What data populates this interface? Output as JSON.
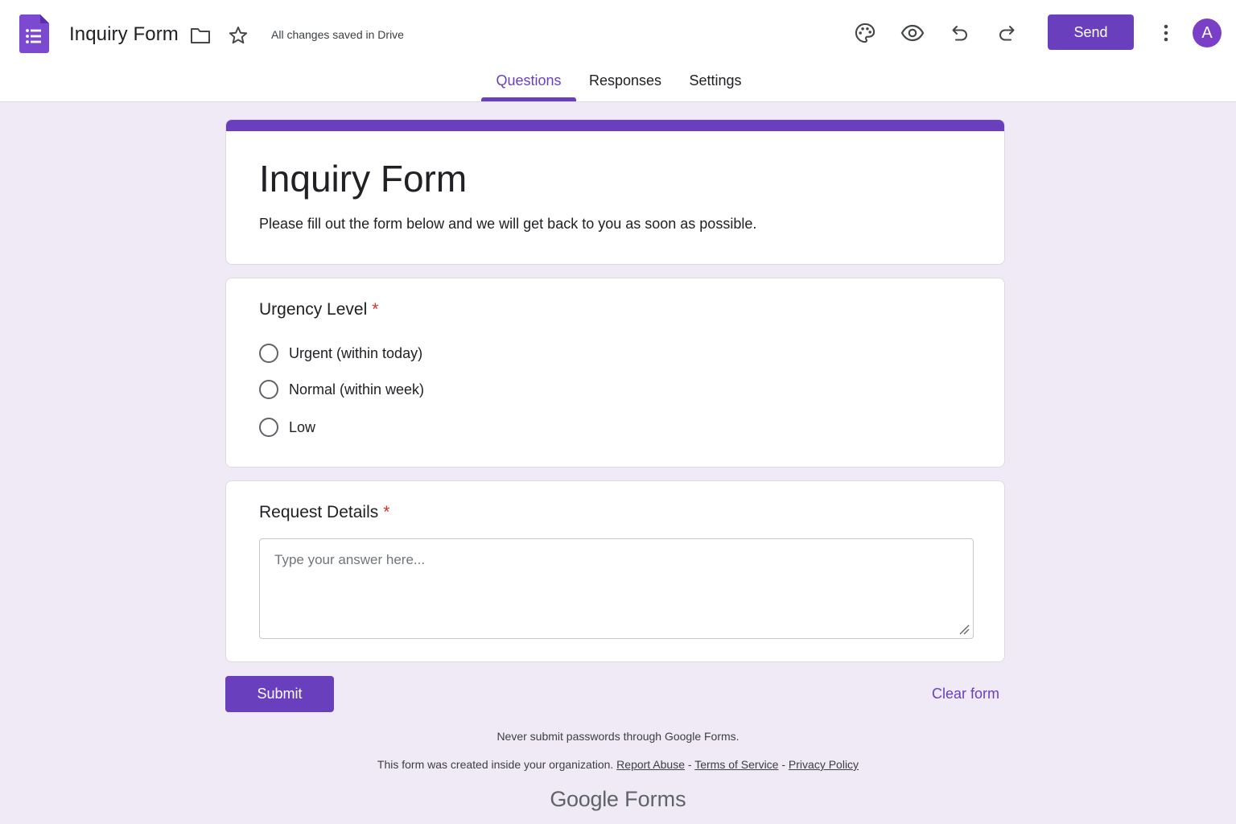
{
  "header": {
    "doc_title": "Inquiry Form",
    "saved_status": "All changes saved in Drive",
    "send_label": "Send",
    "avatar_initial": "A",
    "icons": [
      "forms-app-icon",
      "folder-icon",
      "star-icon",
      "palette-icon",
      "eye-icon",
      "undo-icon",
      "redo-icon",
      "more-vert-icon"
    ]
  },
  "tabs": [
    {
      "label": "Questions",
      "active": true
    },
    {
      "label": "Responses",
      "active": false
    },
    {
      "label": "Settings",
      "active": false
    }
  ],
  "form": {
    "title": "Inquiry Form",
    "description": "Please fill out the form below and we will get back to you as soon as possible."
  },
  "questions": [
    {
      "title": "Urgency Level",
      "required_mark": "*",
      "type": "radio",
      "options": [
        "Urgent (within today)",
        "Normal (within week)",
        "Low"
      ]
    },
    {
      "title": "Request Details",
      "required_mark": "*",
      "type": "paragraph",
      "placeholder": "Type your answer here..."
    }
  ],
  "actions": {
    "submit_label": "Submit",
    "clear_label": "Clear form"
  },
  "footer": {
    "note": "Never submit passwords through Google Forms.",
    "org_text": "This form was created inside your organization.",
    "report_abuse": "Report Abuse",
    "separator": " - ",
    "terms": "Terms of Service",
    "privacy": "Privacy Policy",
    "brand_google": "Google",
    "brand_product": "Forms"
  },
  "colors": {
    "accent": "#6a3fbd",
    "background": "#efeaf6",
    "required": "#d93025"
  }
}
